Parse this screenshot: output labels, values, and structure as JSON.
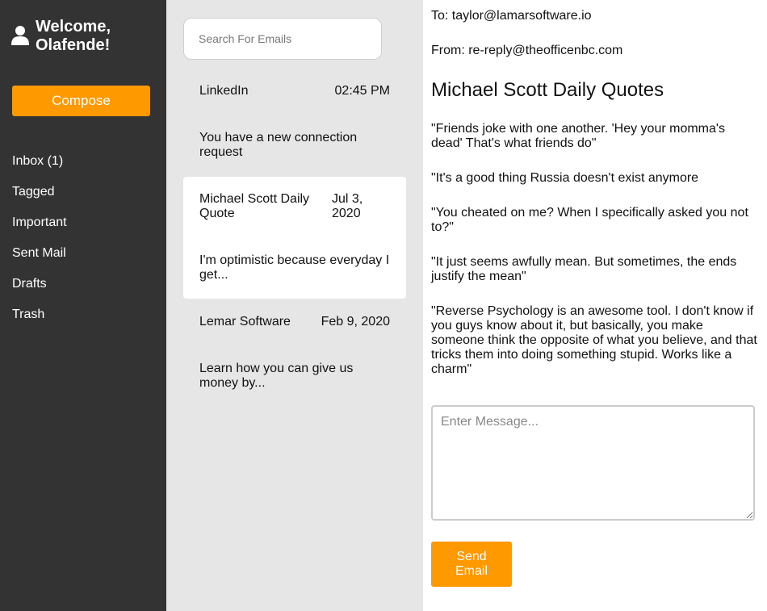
{
  "sidebar": {
    "welcome": "Welcome, Olafende!",
    "compose_label": "Compose",
    "nav": [
      "Inbox (1)",
      "Tagged",
      "Important",
      "Sent Mail",
      "Drafts",
      "Trash"
    ]
  },
  "search": {
    "placeholder": "Search For Emails"
  },
  "emails": [
    {
      "sender": "LinkedIn",
      "date": "02:45 PM",
      "preview": "You have a new connection request"
    },
    {
      "sender": "Michael Scott Daily Quote",
      "date": "Jul 3, 2020",
      "preview": "I'm optimistic because everyday I get..."
    },
    {
      "sender": "Lemar Software",
      "date": "Feb 9, 2020",
      "preview": "Learn how you can give us money by..."
    }
  ],
  "reading": {
    "to": "To: taylor@lamarsoftware.io",
    "from": "From: re-reply@theofficenbc.com",
    "subject": "Michael Scott Daily Quotes",
    "quotes": [
      "\"Friends joke with one another. 'Hey your momma's dead' That's what friends do\"",
      "\"It's a good thing Russia doesn't exist anymore",
      "\"You cheated on me? When I specifically asked you not to?\"",
      "\"It just seems awfully mean. But sometimes, the ends justify the mean\"",
      "\"Reverse Psychology is an awesome tool. I don't know if you guys know about it, but basically, you make someone think the opposite of what you believe, and that tricks them into doing something stupid. Works like a charm\""
    ],
    "message_placeholder": "Enter Message...",
    "send_label": "Send Email"
  },
  "colors": {
    "sidebar_bg": "#333333",
    "accent": "#ff9900",
    "list_bg": "#e6e6e6"
  },
  "icons": {
    "user": "user-icon"
  }
}
